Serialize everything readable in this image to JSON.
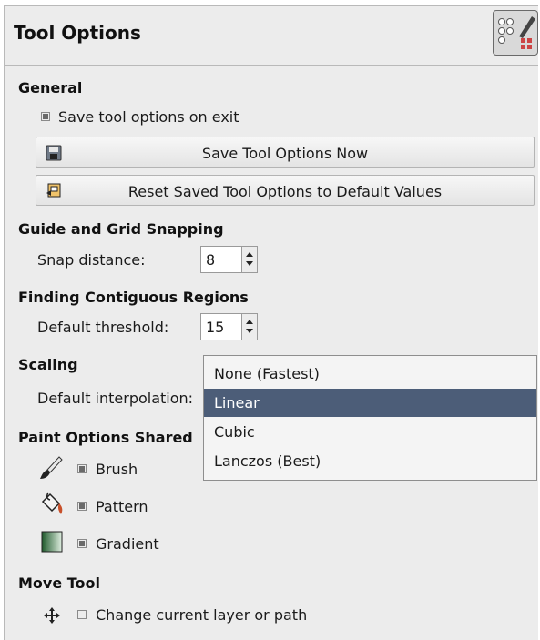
{
  "header": {
    "title": "Tool Options",
    "icon": "tool-options-grid-icon"
  },
  "general": {
    "heading": "General",
    "save_on_exit_label": "Save tool options on exit",
    "save_on_exit_checked": true,
    "save_now_label": "Save Tool Options Now",
    "reset_label": "Reset Saved Tool Options to Default Values"
  },
  "snapping": {
    "heading": "Guide and Grid Snapping",
    "snap_label": "Snap distance:",
    "snap_value": "8"
  },
  "contiguous": {
    "heading": "Finding Contiguous Regions",
    "threshold_label": "Default threshold:",
    "threshold_value": "15"
  },
  "scaling": {
    "heading": "Scaling",
    "interp_label": "Default interpolation:",
    "options": [
      "None (Fastest)",
      "Linear",
      "Cubic",
      "Lanczos (Best)"
    ],
    "selected_index": 1
  },
  "paint": {
    "heading": "Paint Options Shared",
    "items": [
      {
        "label": "Brush",
        "checked": true,
        "icon": "brush-icon"
      },
      {
        "label": "Pattern",
        "checked": true,
        "icon": "bucket-icon"
      },
      {
        "label": "Gradient",
        "checked": true,
        "icon": "gradient-icon"
      }
    ]
  },
  "move": {
    "heading": "Move Tool",
    "change_layer_label": "Change current layer or path",
    "change_layer_checked": false
  },
  "colors": {
    "selection": "#4c5d78",
    "panel": "#ececec"
  }
}
